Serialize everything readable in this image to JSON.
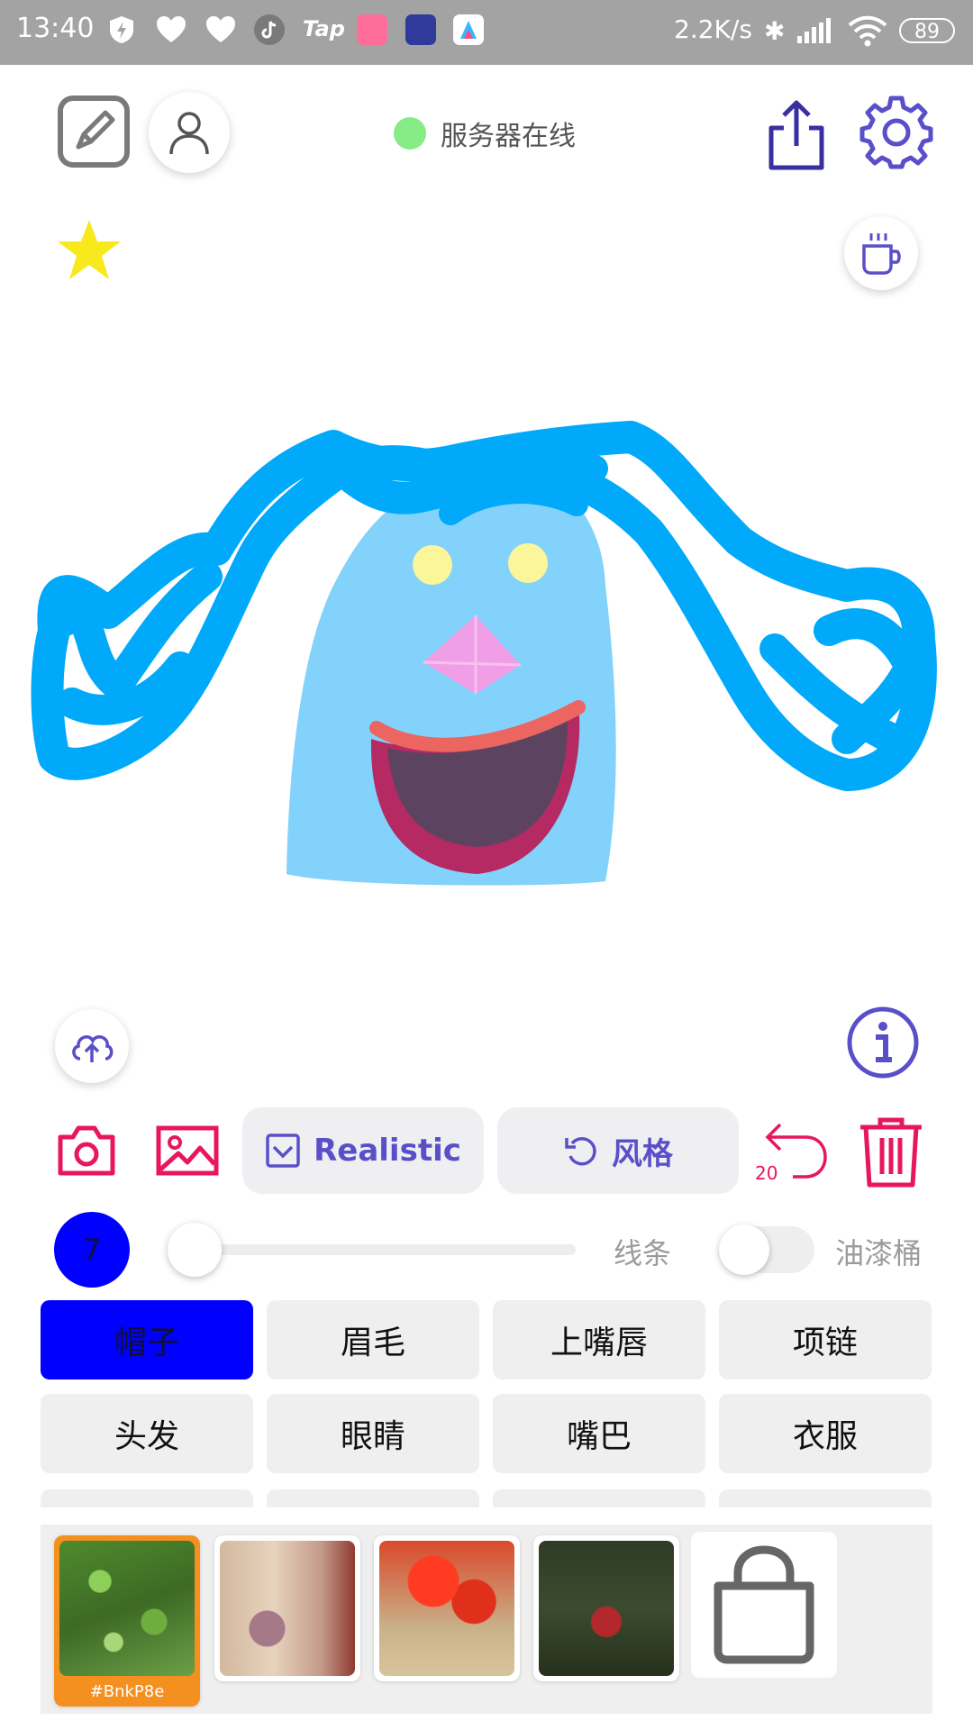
{
  "status_bar": {
    "time": "13:40",
    "speed": "2.2K/s",
    "battery": "89",
    "app_icons": [
      "shield-bolt-icon",
      "heart-pattern-icon",
      "heart-pattern-icon",
      "tiktok-icon",
      "tap-icon",
      "bilibili-icon",
      "tieba-icon",
      "app-icon"
    ]
  },
  "header": {
    "server_status": "服务器在线",
    "server_status_color": "#86ec86"
  },
  "toolbar": {
    "realistic_label": "Realistic",
    "style_label": "风格",
    "undo_count": "20",
    "accent_color": "#5a4fc9",
    "tool_color": "#e8175d"
  },
  "brush": {
    "size": "7",
    "color": "#0000ff",
    "slider_level": 0.0,
    "mode_line": "线条",
    "mode_bucket": "油漆桶",
    "bucket_enabled": false
  },
  "categories": [
    {
      "label": "帽子",
      "active": true
    },
    {
      "label": "眉毛",
      "active": false
    },
    {
      "label": "上嘴唇",
      "active": false
    },
    {
      "label": "项链",
      "active": false
    },
    {
      "label": "头发",
      "active": false
    },
    {
      "label": "眼睛",
      "active": false
    },
    {
      "label": "嘴巴",
      "active": false
    },
    {
      "label": "衣服",
      "active": false
    }
  ],
  "textures": {
    "selected_code": "#BnkP8e",
    "items": [
      "green-foliage-texture",
      "pink-paper-texture",
      "red-flowers-texture",
      "dark-garden-texture"
    ]
  }
}
